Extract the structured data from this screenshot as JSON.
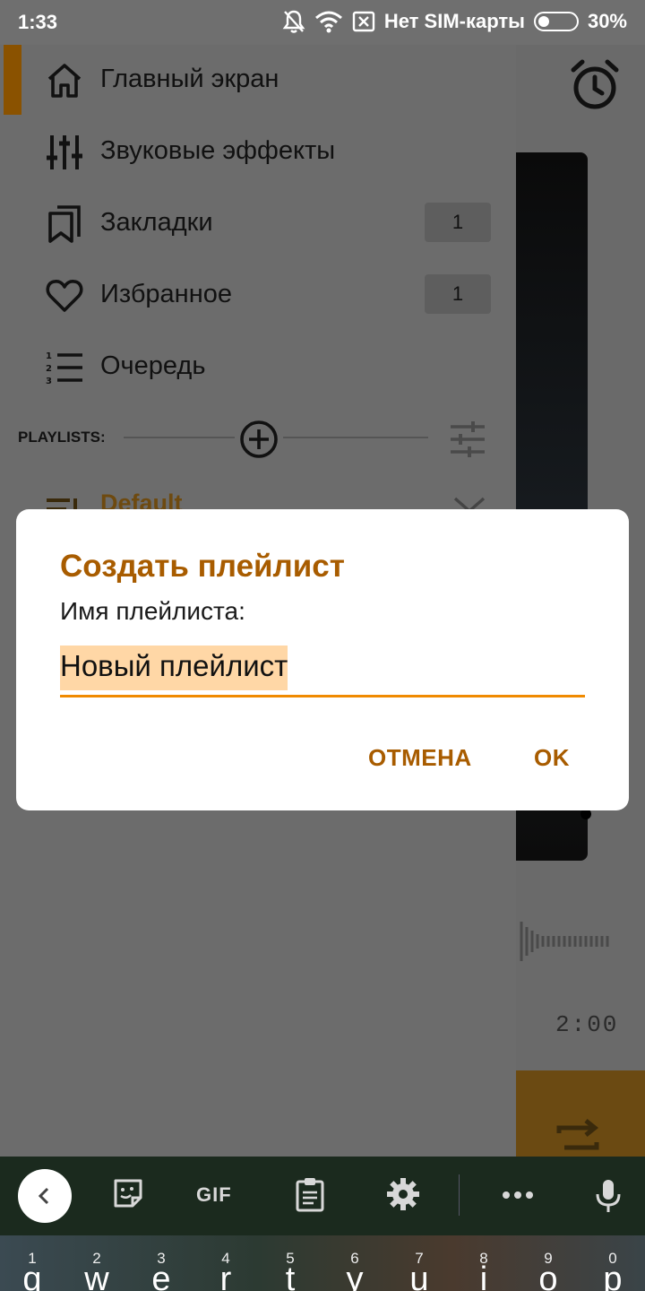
{
  "status_bar": {
    "time": "1:33",
    "carrier": "Нет SIM-карты",
    "battery": "30%",
    "battery_level": 0.3
  },
  "drawer": {
    "nav_items": [
      {
        "label": "Главный экран",
        "icon": "home-icon"
      },
      {
        "label": "Звуковые эффекты",
        "icon": "equalizer-icon"
      },
      {
        "label": "Закладки",
        "icon": "bookmarks-icon",
        "count": "1"
      },
      {
        "label": "Избранное",
        "icon": "heart-icon",
        "count": "1"
      },
      {
        "label": "Очередь",
        "icon": "queue-icon"
      }
    ],
    "playlists_label": "PLAYLISTS:",
    "default_playlist": "Default"
  },
  "player": {
    "time": "2:00"
  },
  "dialog": {
    "title": "Создать плейлист",
    "field_label": "Имя плейлиста:",
    "input_value": "Новый плейлист",
    "cancel_label": "ОТМЕНА",
    "ok_label": "OK"
  },
  "keyboard": {
    "gif_label": "GIF",
    "keys": [
      {
        "hint": "1",
        "char": "q"
      },
      {
        "hint": "2",
        "char": "w"
      },
      {
        "hint": "3",
        "char": "e"
      },
      {
        "hint": "4",
        "char": "r"
      },
      {
        "hint": "5",
        "char": "t"
      },
      {
        "hint": "6",
        "char": "y"
      },
      {
        "hint": "7",
        "char": "u"
      },
      {
        "hint": "8",
        "char": "i"
      },
      {
        "hint": "9",
        "char": "o"
      },
      {
        "hint": "0",
        "char": "p"
      }
    ]
  },
  "colors": {
    "accent": "#a85c00",
    "input_underline": "#f08a00",
    "selection": "#ffd7a6"
  }
}
